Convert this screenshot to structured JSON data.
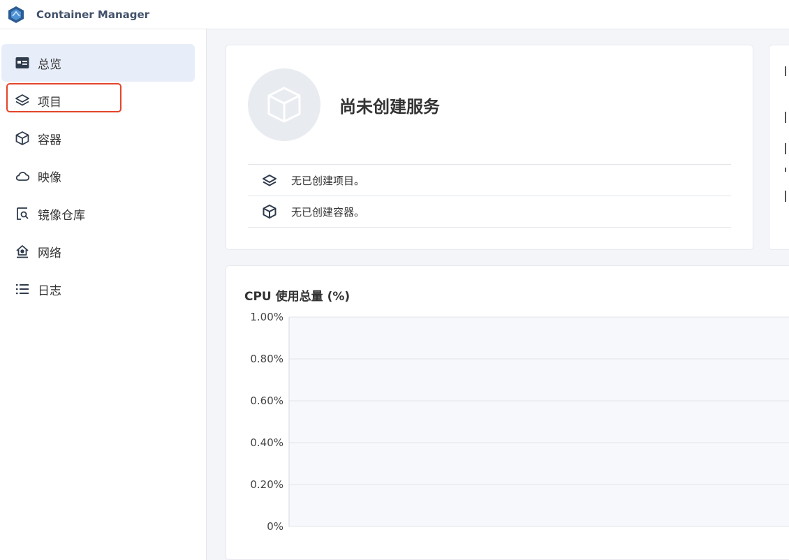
{
  "app": {
    "title": "Container Manager"
  },
  "sidebar": {
    "items": [
      {
        "label": "总览",
        "icon": "overview-icon"
      },
      {
        "label": "项目",
        "icon": "layers-icon"
      },
      {
        "label": "容器",
        "icon": "cube-icon"
      },
      {
        "label": "映像",
        "icon": "cloud-icon"
      },
      {
        "label": "镜像仓库",
        "icon": "registry-search-icon"
      },
      {
        "label": "网络",
        "icon": "network-house-icon"
      },
      {
        "label": "日志",
        "icon": "list-icon"
      }
    ],
    "active": "总览",
    "highlighted": "项目",
    "highlight_color": "#e4442b"
  },
  "status": {
    "title": "尚未创建服务",
    "rows": [
      {
        "text": "无已创建项目。",
        "icon": "layers-icon"
      },
      {
        "text": "无已创建容器。",
        "icon": "cube-icon"
      }
    ]
  },
  "cpu": {
    "title": "CPU 使用总量 (%)"
  },
  "chart_data": {
    "type": "line",
    "title": "CPU 使用总量 (%)",
    "y_ticks": [
      "1.00%",
      "0.80%",
      "0.60%",
      "0.40%",
      "0.20%",
      "0%"
    ],
    "ylim": [
      0,
      1.0
    ],
    "series": [],
    "grid": true
  }
}
